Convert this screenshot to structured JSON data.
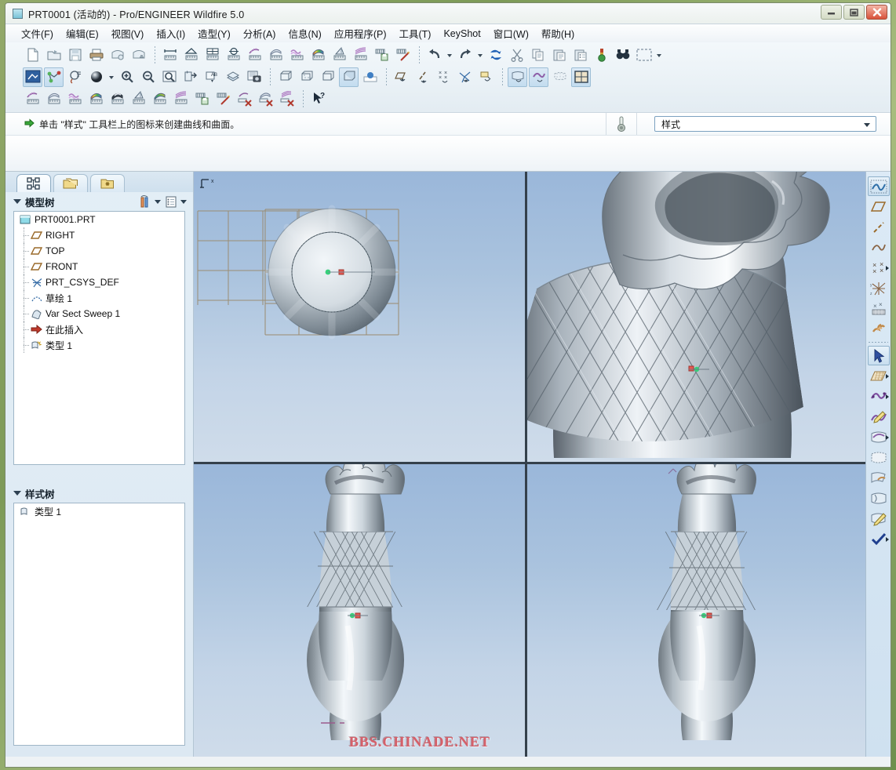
{
  "window": {
    "title": "PRT0001 (活动的) - Pro/ENGINEER Wildfire 5.0",
    "icon": "part-document-icon",
    "buttons": {
      "minimize": "—",
      "maximize": "❐",
      "close": "✕"
    }
  },
  "menubar": {
    "items": [
      {
        "label": "文件(F)",
        "name": "menu-file"
      },
      {
        "label": "编辑(E)",
        "name": "menu-edit"
      },
      {
        "label": "视图(V)",
        "name": "menu-view"
      },
      {
        "label": "插入(I)",
        "name": "menu-insert"
      },
      {
        "label": "造型(Y)",
        "name": "menu-style"
      },
      {
        "label": "分析(A)",
        "name": "menu-analysis"
      },
      {
        "label": "信息(N)",
        "name": "menu-info"
      },
      {
        "label": "应用程序(P)",
        "name": "menu-applications"
      },
      {
        "label": "工具(T)",
        "name": "menu-tools"
      },
      {
        "label": "KeyShot",
        "name": "menu-keyshot"
      },
      {
        "label": "窗口(W)",
        "name": "menu-window"
      },
      {
        "label": "帮助(H)",
        "name": "menu-help"
      }
    ]
  },
  "toolbars": {
    "row1": [
      "new-file-icon",
      "open-folder-icon",
      "save-icon",
      "print-icon",
      "mail-icon",
      "link-icon",
      "sep",
      "measure-distance-icon",
      "measure-angle-icon",
      "measure-area-icon",
      "measure-diameter-icon",
      "curve-analysis-icon",
      "surface-analysis-icon",
      "curvature-analysis-icon",
      "shaded-curvature-icon",
      "draft-analysis-icon",
      "section-analysis-icon",
      "save-analysis-icon",
      "delete-analysis-icon",
      "sep",
      "undo-icon",
      "undo-dropdown",
      "redo-icon",
      "redo-dropdown",
      "regenerate-icon",
      "cut-icon",
      "copy-icon",
      "paste-icon",
      "paste-special-icon",
      "layer-color-icon",
      "find-icon",
      "select-box-icon",
      "select-dropdown"
    ],
    "row2": [
      "repaint-icon",
      "datum-display-icon",
      "spin-center-icon",
      "shading-icon",
      "shading-dropdown",
      "zoom-in-icon",
      "zoom-out-icon",
      "refit-icon",
      "saved-view-icon",
      "annotation-icon",
      "layers-icon",
      "capture-image-icon",
      "sep",
      "wireframe-icon",
      "hidden-line-icon",
      "no-hidden-icon",
      "shaded-icon",
      "shaded-edges-icon",
      "sep",
      "plane-display-icon",
      "axis-display-icon",
      "point-display-icon",
      "csys-display-icon",
      "note-display-icon",
      "sep",
      "surface-create-icon",
      "curve-create-icon",
      "mesh-display-icon",
      "grid-display-icon"
    ],
    "row3": [
      "curve-analysis2-icon",
      "surface-analysis2-icon",
      "curvature2-icon",
      "shaded-curvature2-icon",
      "reflection-icon",
      "draft2-icon",
      "gaussian-icon",
      "section2-icon",
      "save-analysis2-icon",
      "delete-analysis2-icon",
      "curve-del-icon",
      "surface-del-icon",
      "section-del-icon",
      "sep",
      "help-arrow-icon"
    ]
  },
  "messagebar": {
    "arrow_icon": "green-arrow-icon",
    "text": "单击 \"样式\" 工具栏上的图标来创建曲线和曲面。",
    "thermo_icon": "thermometer-icon",
    "select": {
      "value": "样式",
      "name": "style-mode-select"
    }
  },
  "leftpanel": {
    "tabs": [
      {
        "name": "tab-model-tree",
        "icon": "tree-structure-icon",
        "selected": true
      },
      {
        "name": "tab-folder-browser",
        "icon": "folders-icon",
        "selected": false
      },
      {
        "name": "tab-favorites",
        "icon": "favorites-folder-icon",
        "selected": false
      }
    ],
    "modeltree": {
      "title": "模型树",
      "header_icons": [
        "tree-filters-icon",
        "tree-settings-icon"
      ],
      "rows": [
        {
          "label": "PRT0001.PRT",
          "icon": "part-icon",
          "depth": 0
        },
        {
          "label": "RIGHT",
          "icon": "datum-plane-icon",
          "depth": 1
        },
        {
          "label": "TOP",
          "icon": "datum-plane-icon",
          "depth": 1
        },
        {
          "label": "FRONT",
          "icon": "datum-plane-icon",
          "depth": 1
        },
        {
          "label": "PRT_CSYS_DEF",
          "icon": "csys-icon",
          "depth": 1
        },
        {
          "label": "草绘 1",
          "icon": "sketch-icon",
          "depth": 1
        },
        {
          "label": "Var Sect Sweep 1",
          "icon": "sweep-icon",
          "depth": 1
        },
        {
          "label": "在此插入",
          "icon": "insert-here-icon",
          "depth": 1
        },
        {
          "label": "类型 1",
          "icon": "style-feature-icon",
          "depth": 1
        }
      ]
    },
    "styletree": {
      "title": "样式树",
      "rows": [
        {
          "label": "类型 1",
          "icon": "style-feature-icon",
          "depth": 0
        }
      ]
    }
  },
  "righttoolbar": {
    "items": [
      {
        "name": "style-curve-active-icon",
        "active": true,
        "flyout": false
      },
      {
        "name": "set-active-plane-icon",
        "active": false,
        "flyout": false
      },
      {
        "name": "create-line-icon",
        "active": false,
        "flyout": false
      },
      {
        "name": "create-curve-icon",
        "active": false,
        "flyout": false
      },
      {
        "name": "create-points-icon",
        "active": false,
        "flyout": true
      },
      {
        "name": "create-csys-icon",
        "active": false,
        "flyout": false
      },
      {
        "name": "point-cloud-icon",
        "active": false,
        "flyout": false
      },
      {
        "name": "chain-connect-icon",
        "active": false,
        "flyout": false
      },
      {
        "name": "separator",
        "active": false,
        "flyout": false
      },
      {
        "name": "select-arrow-icon",
        "active": true,
        "flyout": false
      },
      {
        "name": "drop-curve-icon",
        "active": false,
        "flyout": true
      },
      {
        "name": "edit-curve-icon",
        "active": false,
        "flyout": true
      },
      {
        "name": "curve-edit-pen-icon",
        "active": false,
        "flyout": false
      },
      {
        "name": "create-surface-icon",
        "active": false,
        "flyout": true
      },
      {
        "name": "surface-trim-icon",
        "active": false,
        "flyout": false
      },
      {
        "name": "surface-connect-icon",
        "active": false,
        "flyout": false
      },
      {
        "name": "surface-offset-icon",
        "active": false,
        "flyout": false
      },
      {
        "name": "surface-edit-icon",
        "active": false,
        "flyout": false
      },
      {
        "name": "accept-check-icon",
        "active": false,
        "flyout": true
      }
    ]
  },
  "graphics": {
    "viewports": [
      {
        "name": "viewport-top-view",
        "axis_label": "x",
        "has_grid": true
      },
      {
        "name": "viewport-detail-view",
        "axis_label": "",
        "has_grid": false
      },
      {
        "name": "viewport-front-view",
        "axis_label": "",
        "has_grid": false
      },
      {
        "name": "viewport-iso-view",
        "axis_label": "",
        "has_grid": false
      }
    ],
    "watermark": "BBS.CHINADE.NET"
  },
  "colors": {
    "accent": "#3f6fa8",
    "viewport_top": "#9ab7da",
    "viewport_bottom": "#cfdcea",
    "watermark": "#d4606a",
    "chrome": "#e3ecf2"
  }
}
